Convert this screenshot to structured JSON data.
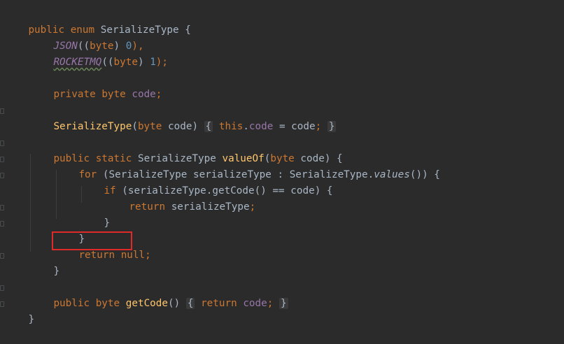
{
  "code": {
    "l1": {
      "kw1": "public",
      "kw2": "enum",
      "name": "SerializeType",
      "brace": "{"
    },
    "l2": {
      "field": "JSON",
      "args_open": "((",
      "kw": "byte",
      "close": ")",
      "num": "0",
      "end": "),"
    },
    "l3": {
      "field": "ROCKETMQ",
      "args_open": "((",
      "kw": "byte",
      "close": ")",
      "num": "1",
      "end": ");"
    },
    "l5": {
      "kw1": "private",
      "kw2": "byte",
      "field": "code",
      "semi": ";"
    },
    "l7": {
      "ctor": "SerializeType",
      "paren_open": "(",
      "kw": "byte",
      "param": "code",
      "paren_close": ")",
      "brace_open": "{",
      "this_kw": "this",
      "dot": ".",
      "field": "code",
      "assign": " = code",
      "semi": ";",
      "brace_close": "}"
    },
    "l9": {
      "kw1": "public",
      "kw2": "static",
      "type": "SerializeType",
      "method": "valueOf",
      "paren_open": "(",
      "kw3": "byte",
      "rest": " code) {"
    },
    "l10": {
      "kw": "for",
      "text1": " (SerializeType serializeType : SerializeType.",
      "static_call": "values",
      "text2": "()) {"
    },
    "l11": {
      "kw": "if",
      "text": " (serializeType.getCode() == code) {"
    },
    "l12": {
      "kw": "return",
      "text": " serializeType",
      "semi": ";"
    },
    "l13": {
      "text": "}"
    },
    "l14": {
      "text": "}"
    },
    "l15": {
      "kw1": "return",
      "kw2": "null",
      "semi": ";"
    },
    "l16": {
      "text": "}"
    },
    "l18": {
      "kw1": "public",
      "kw2": "byte",
      "method": "getCode",
      "parens": "()",
      "brace_open": "{",
      "kw3": "return",
      "field": "code",
      "semi": ";",
      "brace_close": "}"
    },
    "l19": {
      "text": "}"
    }
  }
}
